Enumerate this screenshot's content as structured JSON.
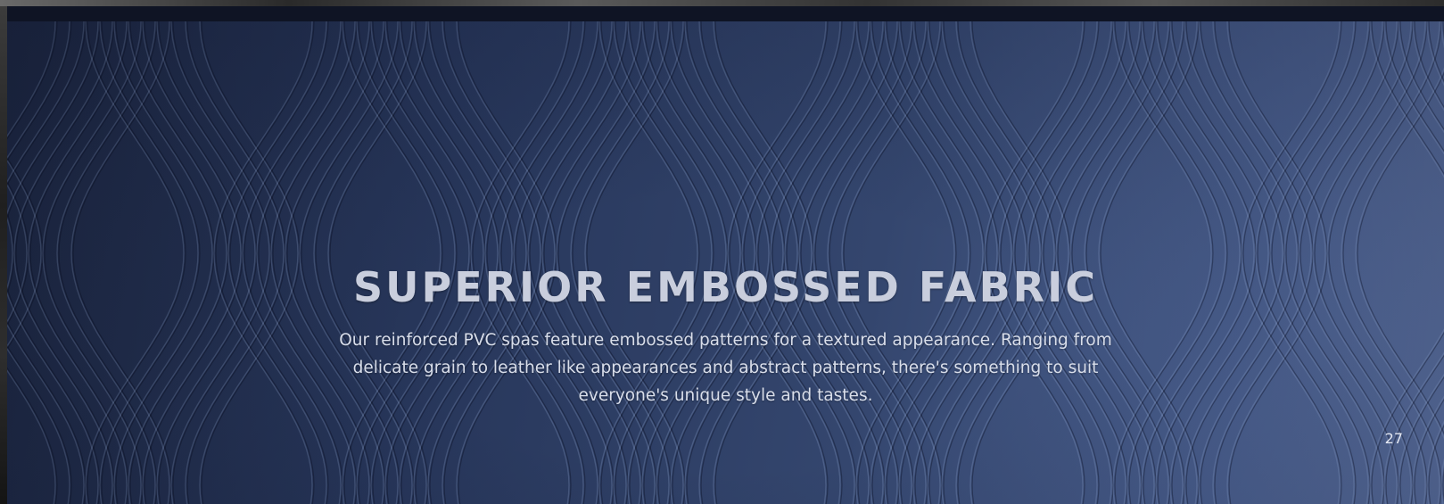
{
  "page": {
    "title": "SUPERIOR EMBOSSED FABRIC",
    "body": "Our reinforced PVC spas feature embossed patterns for a textured appearance. Ranging from delicate grain to leather like appearances and abstract patterns, there's something to suit everyone's unique style and tastes.",
    "page_number": "27"
  },
  "colors": {
    "background_dark": "#1c2640",
    "background_light": "#5a6f9e",
    "header_bar": "#0f1424",
    "title_text": "#c9cedd",
    "body_text": "#d9deea"
  },
  "decor": {
    "background_image": "embossed-wave-line-pattern"
  }
}
